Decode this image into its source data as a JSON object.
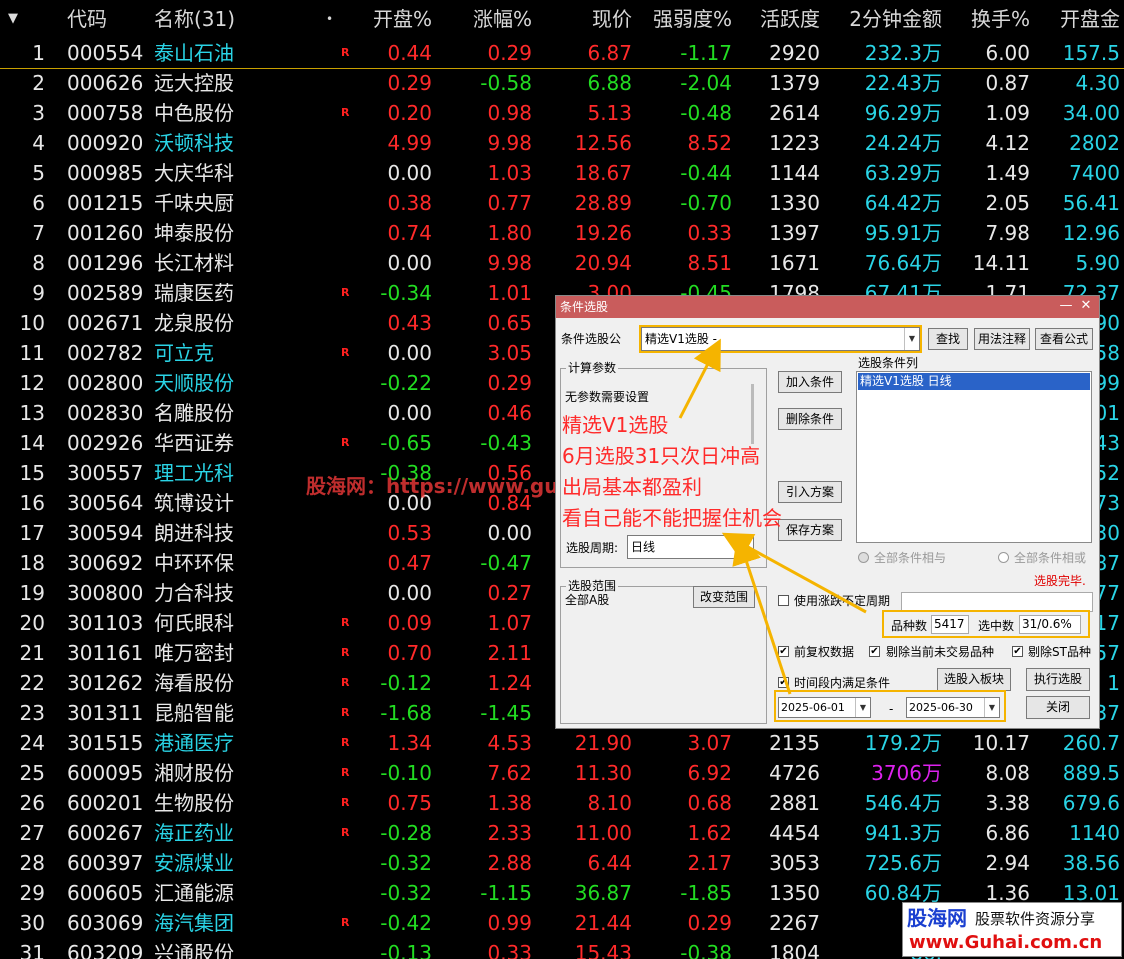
{
  "header": {
    "columns": [
      "代码",
      "名称(31)",
      "开盘%",
      "涨幅%",
      "现价",
      "强弱度%",
      "活跃度",
      "2分钟金额",
      "换手%",
      "开盘金"
    ],
    "sort_marker": "•"
  },
  "rows": [
    {
      "no": "1",
      "code": "000554",
      "name": "泰山石油",
      "name_color": "cyan",
      "flag": "R",
      "open": "0.44",
      "open_c": "red",
      "chg": "0.29",
      "chg_c": "red",
      "price": "6.87",
      "price_c": "red",
      "str": "-1.17",
      "str_c": "green",
      "act": "2920",
      "amt2": "232.3万",
      "amt2_c": "cyan",
      "turn": "6.00",
      "oamt": "157.5",
      "oamt_c": "cyan"
    },
    {
      "no": "2",
      "code": "000626",
      "name": "远大控股",
      "name_color": "white",
      "flag": "",
      "open": "0.29",
      "open_c": "red",
      "chg": "-0.58",
      "chg_c": "green",
      "price": "6.88",
      "price_c": "green",
      "str": "-2.04",
      "str_c": "green",
      "act": "1379",
      "amt2": "22.43万",
      "amt2_c": "cyan",
      "turn": "0.87",
      "oamt": "4.30",
      "oamt_c": "cyan"
    },
    {
      "no": "3",
      "code": "000758",
      "name": "中色股份",
      "name_color": "white",
      "flag": "R",
      "open": "0.20",
      "open_c": "red",
      "chg": "0.98",
      "chg_c": "red",
      "price": "5.13",
      "price_c": "red",
      "str": "-0.48",
      "str_c": "green",
      "act": "2614",
      "amt2": "96.29万",
      "amt2_c": "cyan",
      "turn": "1.09",
      "oamt": "34.00",
      "oamt_c": "cyan"
    },
    {
      "no": "4",
      "code": "000920",
      "name": "沃顿科技",
      "name_color": "cyan",
      "flag": "",
      "open": "4.99",
      "open_c": "red",
      "chg": "9.98",
      "chg_c": "red",
      "price": "12.56",
      "price_c": "red",
      "str": "8.52",
      "str_c": "red",
      "act": "1223",
      "amt2": "24.24万",
      "amt2_c": "cyan",
      "turn": "4.12",
      "oamt": "2802",
      "oamt_c": "cyan"
    },
    {
      "no": "5",
      "code": "000985",
      "name": "大庆华科",
      "name_color": "white",
      "flag": "",
      "open": "0.00",
      "open_c": "white",
      "chg": "1.03",
      "chg_c": "red",
      "price": "18.67",
      "price_c": "red",
      "str": "-0.44",
      "str_c": "green",
      "act": "1144",
      "amt2": "63.29万",
      "amt2_c": "cyan",
      "turn": "1.49",
      "oamt": "7400",
      "oamt_c": "cyan"
    },
    {
      "no": "6",
      "code": "001215",
      "name": "千味央厨",
      "name_color": "white",
      "flag": "",
      "open": "0.38",
      "open_c": "red",
      "chg": "0.77",
      "chg_c": "red",
      "price": "28.89",
      "price_c": "red",
      "str": "-0.70",
      "str_c": "green",
      "act": "1330",
      "amt2": "64.42万",
      "amt2_c": "cyan",
      "turn": "2.05",
      "oamt": "56.41",
      "oamt_c": "cyan"
    },
    {
      "no": "7",
      "code": "001260",
      "name": "坤泰股份",
      "name_color": "white",
      "flag": "",
      "open": "0.74",
      "open_c": "red",
      "chg": "1.80",
      "chg_c": "red",
      "price": "19.26",
      "price_c": "red",
      "str": "0.33",
      "str_c": "red",
      "act": "1397",
      "amt2": "95.91万",
      "amt2_c": "cyan",
      "turn": "7.98",
      "oamt": "12.96",
      "oamt_c": "cyan"
    },
    {
      "no": "8",
      "code": "001296",
      "name": "长江材料",
      "name_color": "white",
      "flag": "",
      "open": "0.00",
      "open_c": "white",
      "chg": "9.98",
      "chg_c": "red",
      "price": "20.94",
      "price_c": "red",
      "str": "8.51",
      "str_c": "red",
      "act": "1671",
      "amt2": "76.64万",
      "amt2_c": "cyan",
      "turn": "14.11",
      "oamt": "5.90",
      "oamt_c": "cyan"
    },
    {
      "no": "9",
      "code": "002589",
      "name": "瑞康医药",
      "name_color": "white",
      "flag": "R",
      "open": "-0.34",
      "open_c": "green",
      "chg": "1.01",
      "chg_c": "red",
      "price": "3.00",
      "price_c": "red",
      "str": "-0.45",
      "str_c": "green",
      "act": "1798",
      "amt2": "67.41万",
      "amt2_c": "cyan",
      "turn": "1.71",
      "oamt": "72.37",
      "oamt_c": "cyan"
    },
    {
      "no": "10",
      "code": "002671",
      "name": "龙泉股份",
      "name_color": "white",
      "flag": "",
      "open": "0.43",
      "open_c": "red",
      "chg": "0.65",
      "chg_c": "red",
      "price": "",
      "price_c": "red",
      "str": "",
      "str_c": "red",
      "act": "",
      "amt2": "",
      "amt2_c": "cyan",
      "turn": "",
      "oamt": "90",
      "oamt_c": "cyan"
    },
    {
      "no": "11",
      "code": "002782",
      "name": "可立克",
      "name_color": "cyan",
      "flag": "R",
      "open": "0.00",
      "open_c": "white",
      "chg": "3.05",
      "chg_c": "red",
      "price": "",
      "price_c": "red",
      "str": "",
      "str_c": "red",
      "act": "",
      "amt2": "",
      "amt2_c": "cyan",
      "turn": "",
      "oamt": "58",
      "oamt_c": "cyan"
    },
    {
      "no": "12",
      "code": "002800",
      "name": "天顺股份",
      "name_color": "cyan",
      "flag": "",
      "open": "-0.22",
      "open_c": "green",
      "chg": "0.29",
      "chg_c": "red",
      "price": "",
      "price_c": "red",
      "str": "",
      "str_c": "red",
      "act": "",
      "amt2": "",
      "amt2_c": "cyan",
      "turn": "",
      "oamt": "99",
      "oamt_c": "cyan"
    },
    {
      "no": "13",
      "code": "002830",
      "name": "名雕股份",
      "name_color": "white",
      "flag": "",
      "open": "0.00",
      "open_c": "white",
      "chg": "0.46",
      "chg_c": "red",
      "price": "",
      "price_c": "red",
      "str": "",
      "str_c": "red",
      "act": "",
      "amt2": "",
      "amt2_c": "cyan",
      "turn": "",
      "oamt": "01",
      "oamt_c": "cyan"
    },
    {
      "no": "14",
      "code": "002926",
      "name": "华西证券",
      "name_color": "white",
      "flag": "R",
      "open": "-0.65",
      "open_c": "green",
      "chg": "-0.43",
      "chg_c": "green",
      "price": "",
      "price_c": "red",
      "str": "",
      "str_c": "red",
      "act": "",
      "amt2": "",
      "amt2_c": "cyan",
      "turn": "",
      "oamt": "43",
      "oamt_c": "cyan"
    },
    {
      "no": "15",
      "code": "300557",
      "name": "理工光科",
      "name_color": "cyan",
      "flag": "",
      "open": "-0.38",
      "open_c": "green",
      "chg": "0.56",
      "chg_c": "red",
      "price": "",
      "price_c": "red",
      "str": "",
      "str_c": "red",
      "act": "",
      "amt2": "",
      "amt2_c": "cyan",
      "turn": "",
      "oamt": "52",
      "oamt_c": "cyan"
    },
    {
      "no": "16",
      "code": "300564",
      "name": "筑博设计",
      "name_color": "white",
      "flag": "",
      "open": "0.00",
      "open_c": "white",
      "chg": "0.84",
      "chg_c": "red",
      "price": "",
      "price_c": "red",
      "str": "",
      "str_c": "red",
      "act": "",
      "amt2": "",
      "amt2_c": "cyan",
      "turn": "",
      "oamt": "73",
      "oamt_c": "cyan"
    },
    {
      "no": "17",
      "code": "300594",
      "name": "朗进科技",
      "name_color": "white",
      "flag": "",
      "open": "0.53",
      "open_c": "red",
      "chg": "0.00",
      "chg_c": "white",
      "price": "",
      "price_c": "red",
      "str": "",
      "str_c": "red",
      "act": "",
      "amt2": "",
      "amt2_c": "cyan",
      "turn": "",
      "oamt": "30",
      "oamt_c": "cyan"
    },
    {
      "no": "18",
      "code": "300692",
      "name": "中环环保",
      "name_color": "white",
      "flag": "",
      "open": "0.47",
      "open_c": "red",
      "chg": "-0.47",
      "chg_c": "green",
      "price": "",
      "price_c": "red",
      "str": "",
      "str_c": "red",
      "act": "",
      "amt2": "",
      "amt2_c": "cyan",
      "turn": "",
      "oamt": "4.87",
      "oamt_c": "cyan"
    },
    {
      "no": "19",
      "code": "300800",
      "name": "力合科技",
      "name_color": "white",
      "flag": "",
      "open": "0.00",
      "open_c": "white",
      "chg": "0.27",
      "chg_c": "red",
      "price": "",
      "price_c": "red",
      "str": "",
      "str_c": "red",
      "act": "",
      "amt2": "",
      "amt2_c": "cyan",
      "turn": "",
      "oamt": "77",
      "oamt_c": "cyan"
    },
    {
      "no": "20",
      "code": "301103",
      "name": "何氏眼科",
      "name_color": "white",
      "flag": "R",
      "open": "0.09",
      "open_c": "red",
      "chg": "1.07",
      "chg_c": "red",
      "price": "",
      "price_c": "red",
      "str": "",
      "str_c": "red",
      "act": "",
      "amt2": "",
      "amt2_c": "cyan",
      "turn": "",
      "oamt": "17",
      "oamt_c": "cyan"
    },
    {
      "no": "21",
      "code": "301161",
      "name": "唯万密封",
      "name_color": "white",
      "flag": "R",
      "open": "0.70",
      "open_c": "red",
      "chg": "2.11",
      "chg_c": "red",
      "price": "",
      "price_c": "red",
      "str": "",
      "str_c": "red",
      "act": "",
      "amt2": "",
      "amt2_c": "cyan",
      "turn": "",
      "oamt": "57",
      "oamt_c": "cyan"
    },
    {
      "no": "22",
      "code": "301262",
      "name": "海看股份",
      "name_color": "white",
      "flag": "R",
      "open": "-0.12",
      "open_c": "green",
      "chg": "1.24",
      "chg_c": "red",
      "price": "",
      "price_c": "red",
      "str": "",
      "str_c": "red",
      "act": "",
      "amt2": "",
      "amt2_c": "cyan",
      "turn": "",
      "oamt": "1",
      "oamt_c": "cyan"
    },
    {
      "no": "23",
      "code": "301311",
      "name": "昆船智能",
      "name_color": "white",
      "flag": "R",
      "open": "-1.68",
      "open_c": "green",
      "chg": "-1.45",
      "chg_c": "green",
      "price": "",
      "price_c": "red",
      "str": "",
      "str_c": "red",
      "act": "",
      "amt2": "",
      "amt2_c": "cyan",
      "turn": "",
      "oamt": "3.37",
      "oamt_c": "cyan"
    },
    {
      "no": "24",
      "code": "301515",
      "name": "港通医疗",
      "name_color": "cyan",
      "flag": "R",
      "open": "1.34",
      "open_c": "red",
      "chg": "4.53",
      "chg_c": "red",
      "price": "21.90",
      "price_c": "red",
      "str": "3.07",
      "str_c": "red",
      "act": "2135",
      "amt2": "179.2万",
      "amt2_c": "cyan",
      "turn": "10.17",
      "oamt": "260.7",
      "oamt_c": "cyan"
    },
    {
      "no": "25",
      "code": "600095",
      "name": "湘财股份",
      "name_color": "white",
      "flag": "R",
      "open": "-0.10",
      "open_c": "green",
      "chg": "7.62",
      "chg_c": "red",
      "price": "11.30",
      "price_c": "red",
      "str": "6.92",
      "str_c": "red",
      "act": "4726",
      "amt2": "3706万",
      "amt2_c": "purple",
      "turn": "8.08",
      "oamt": "889.5",
      "oamt_c": "cyan"
    },
    {
      "no": "26",
      "code": "600201",
      "name": "生物股份",
      "name_color": "white",
      "flag": "R",
      "open": "0.75",
      "open_c": "red",
      "chg": "1.38",
      "chg_c": "red",
      "price": "8.10",
      "price_c": "red",
      "str": "0.68",
      "str_c": "red",
      "act": "2881",
      "amt2": "546.4万",
      "amt2_c": "cyan",
      "turn": "3.38",
      "oamt": "679.6",
      "oamt_c": "cyan"
    },
    {
      "no": "27",
      "code": "600267",
      "name": "海正药业",
      "name_color": "cyan",
      "flag": "R",
      "open": "-0.28",
      "open_c": "green",
      "chg": "2.33",
      "chg_c": "red",
      "price": "11.00",
      "price_c": "red",
      "str": "1.62",
      "str_c": "red",
      "act": "4454",
      "amt2": "941.3万",
      "amt2_c": "cyan",
      "turn": "6.86",
      "oamt": "1140",
      "oamt_c": "cyan"
    },
    {
      "no": "28",
      "code": "600397",
      "name": "安源煤业",
      "name_color": "cyan",
      "flag": "",
      "open": "-0.32",
      "open_c": "green",
      "chg": "2.88",
      "chg_c": "red",
      "price": "6.44",
      "price_c": "red",
      "str": "2.17",
      "str_c": "red",
      "act": "3053",
      "amt2": "725.6万",
      "amt2_c": "cyan",
      "turn": "2.94",
      "oamt": "38.56",
      "oamt_c": "cyan"
    },
    {
      "no": "29",
      "code": "600605",
      "name": "汇通能源",
      "name_color": "white",
      "flag": "",
      "open": "-0.32",
      "open_c": "green",
      "chg": "-1.15",
      "chg_c": "green",
      "price": "36.87",
      "price_c": "green",
      "str": "-1.85",
      "str_c": "green",
      "act": "1350",
      "amt2": "60.84万",
      "amt2_c": "cyan",
      "turn": "1.36",
      "oamt": "13.01",
      "oamt_c": "cyan"
    },
    {
      "no": "30",
      "code": "603069",
      "name": "海汽集团",
      "name_color": "cyan",
      "flag": "R",
      "open": "-0.42",
      "open_c": "green",
      "chg": "0.99",
      "chg_c": "red",
      "price": "21.44",
      "price_c": "red",
      "str": "0.29",
      "str_c": "red",
      "act": "2267",
      "amt2": "245",
      "amt2_c": "cyan",
      "turn": "",
      "oamt": "",
      "oamt_c": "cyan"
    },
    {
      "no": "31",
      "code": "603209",
      "name": "兴通股份",
      "name_color": "white",
      "flag": "",
      "open": "-0.13",
      "open_c": "green",
      "chg": "0.33",
      "chg_c": "red",
      "price": "15.43",
      "price_c": "red",
      "str": "-0.38",
      "str_c": "green",
      "act": "1804",
      "amt2": "86.",
      "amt2_c": "cyan",
      "turn": "",
      "oamt": "",
      "oamt_c": "cyan"
    }
  ],
  "dialog": {
    "title": "条件选股",
    "minimize": "—",
    "close": "✕",
    "formula_label": "条件选股公",
    "formula_value": "精选V1选股  -",
    "find_btn": "查找",
    "usage_btn": "用法注释",
    "view_formula_btn": "查看公式",
    "calc_params_label": "计算参数",
    "no_params_text": "无参数需要设置",
    "add_cond_btn": "加入条件",
    "del_cond_btn": "删除条件",
    "import_plan_btn": "引入方案",
    "save_plan_btn": "保存方案",
    "cond_list_label": "选股条件列",
    "cond_list_item": "精选V1选股  日线",
    "period_label": "选股周期:",
    "period_value": "日线",
    "all_and": "全部条件相与",
    "all_or": "全部条件相或",
    "done_text": "选股完毕.",
    "range_label": "选股范围",
    "range_value": "全部A股",
    "change_range_btn": "改变范围",
    "use_chg_label": "使用涨跌不定周期",
    "count_label": "品种数",
    "count_value": "5417",
    "selected_label": "选中数",
    "selected_value": "31/0.6%",
    "pre_adjust": "前复权数据",
    "exclude_untraded": "剔除当前未交易品种",
    "exclude_st": "剔除ST品种",
    "time_range": "时间段内满足条件",
    "to_block_btn": "选股入板块",
    "run_btn": "执行选股",
    "date_from": "2025-06-01",
    "date_sep": "-",
    "date_to": "2025-06-30",
    "close_btn": "关闭"
  },
  "annotation": {
    "lines": [
      "精选V1选股",
      "6月选股31只次日冲高",
      "出局基本都盈利",
      "看自己能不能把握住机会"
    ]
  },
  "watermark": {
    "text": "股海网：https://www.guhai.com.cn",
    "logo_main": "股海网",
    "logo_tagline": "股票软件资源分享",
    "logo_url": "www.Guhai.com.cn"
  },
  "colors": {
    "red": "#ff2a2a",
    "green": "#22dd22",
    "cyan": "#2ad4e6",
    "purple": "#dd22ee",
    "highlight": "#f5b400",
    "titlebar": "#c95c5c"
  }
}
